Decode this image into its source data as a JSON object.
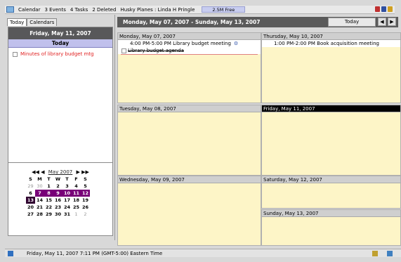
{
  "topbar": {
    "calendar": "Calendar",
    "events": "3 Events",
    "tasks": "4 Tasks",
    "deleted": "2 Deleted",
    "user": "Husky Planes : Linda H Pringle",
    "free": "2.5M Free"
  },
  "left": {
    "tabs": [
      "Today",
      "Calendars"
    ],
    "today_date": "Friday, May 11, 2007",
    "today_label": "Today",
    "task": "Minutes of library budget mtg"
  },
  "minical": {
    "nav_prev_year": "◀◀",
    "nav_prev": "◀",
    "month": "May 2007",
    "nav_next": "▶",
    "nav_next_year": "▶▶",
    "weekdays": [
      "S",
      "M",
      "T",
      "W",
      "T",
      "F",
      "S"
    ],
    "weeks": [
      [
        "29",
        "30",
        "1",
        "2",
        "3",
        "4",
        "5"
      ],
      [
        "6",
        "7",
        "8",
        "9",
        "10",
        "11",
        "12"
      ],
      [
        "13",
        "14",
        "15",
        "16",
        "17",
        "18",
        "19"
      ],
      [
        "20",
        "21",
        "22",
        "23",
        "24",
        "25",
        "26"
      ],
      [
        "27",
        "28",
        "29",
        "30",
        "31",
        "1",
        "2"
      ]
    ]
  },
  "main": {
    "range": "Monday, May 07, 2007 - Sunday, May 13, 2007",
    "today_button": "Today",
    "prev": "◀",
    "next": "▶",
    "days": {
      "mon": {
        "title": "Monday, May 07, 2007"
      },
      "thu": {
        "title": "Thursday, May 10, 2007"
      },
      "tue": {
        "title": "Tuesday, May 08, 2007"
      },
      "fri": {
        "title": "Friday, May 11, 2007"
      },
      "wed": {
        "title": "Wednesday, May 09, 2007"
      },
      "sat": {
        "title": "Saturday, May 12, 2007"
      },
      "sun": {
        "title": "Sunday, May 13, 2007"
      }
    },
    "events": {
      "mon_event": "4:00 PM-5:00 PM Library budget meeting",
      "mon_task": "Library budget agenda",
      "thu_event": "1:00 PM-2:00 PM Book acquisition meeting"
    }
  },
  "status": {
    "text": "Friday, May 11, 2007 7:11 PM (GMT-5:00) Eastern Time"
  },
  "colors": {
    "header_dark": "#5a5a5a",
    "today_band": "#c0c0ec",
    "selected_week": "#780078",
    "day_bg": "#fdf5c7",
    "task_text": "#e02020"
  }
}
